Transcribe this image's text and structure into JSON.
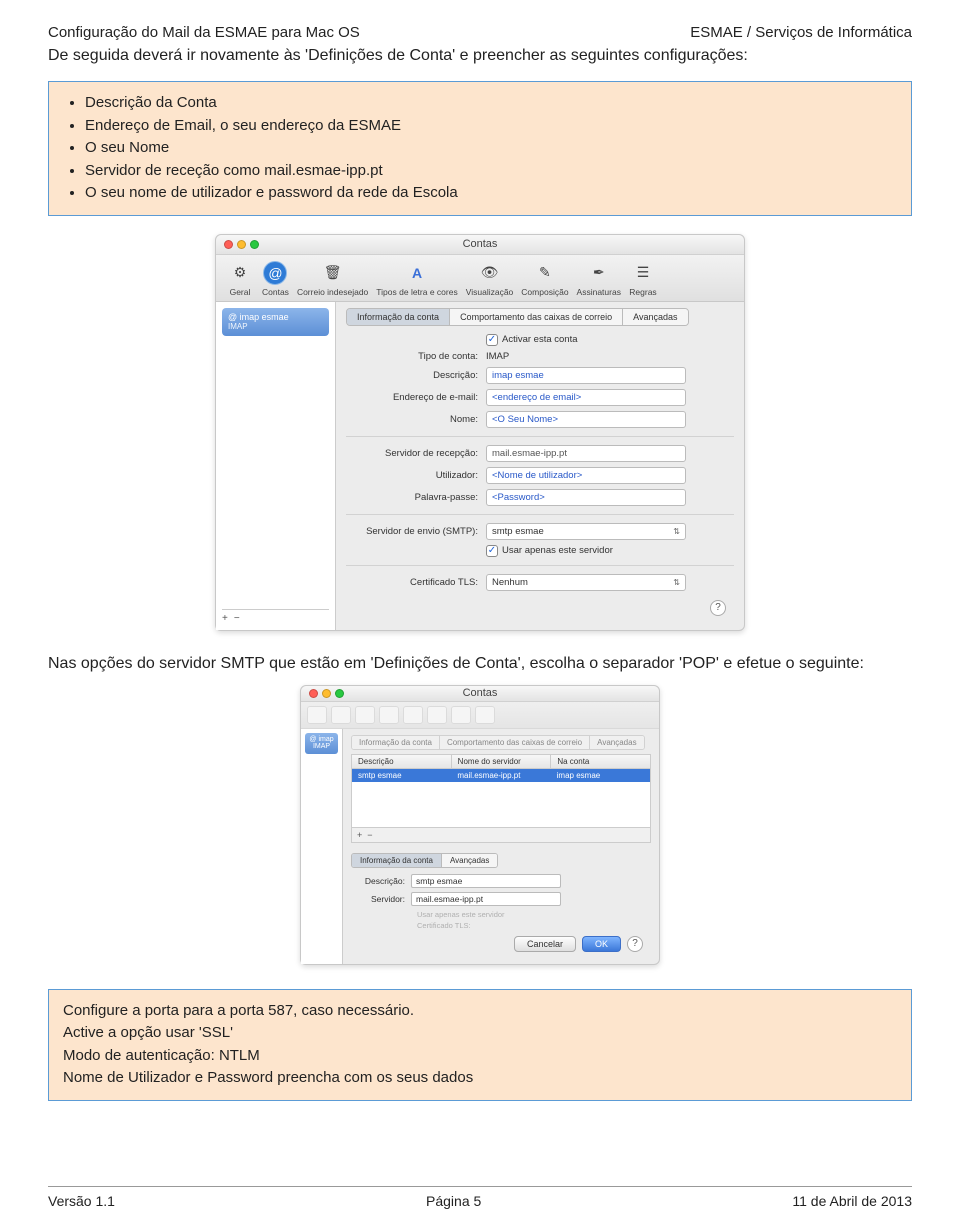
{
  "header": {
    "left": "Configuração do Mail da ESMAE para Mac OS",
    "right": "ESMAE / Serviços de Informática"
  },
  "intro": "De seguida deverá ir novamente às 'Definições de Conta' e preencher as seguintes configurações:",
  "box1_items": [
    "Descrição da Conta",
    "Endereço de Email, o seu endereço da ESMAE",
    "O seu Nome",
    "Servidor de receção como mail.esmae-ipp.pt",
    "O seu nome de utilizador e password da rede da Escola"
  ],
  "win1": {
    "title": "Contas",
    "toolbar": [
      {
        "label": "Geral",
        "icon": "⚙"
      },
      {
        "label": "Contas",
        "icon": "@",
        "sel": true
      },
      {
        "label": "Correio indesejado",
        "icon": "✉"
      },
      {
        "label": "Tipos de letra e cores",
        "icon": "A"
      },
      {
        "label": "Visualização",
        "icon": "👁"
      },
      {
        "label": "Composição",
        "icon": "✎"
      },
      {
        "label": "Assinaturas",
        "icon": "✒"
      },
      {
        "label": "Regras",
        "icon": "☰"
      }
    ],
    "account_name": "imap esmae",
    "account_sub": "IMAP",
    "tabs": [
      "Informação da conta",
      "Comportamento das caixas de correio",
      "Avançadas"
    ],
    "tab_sel": 0,
    "activate_label": "Activar esta conta",
    "type_label": "Tipo de conta:",
    "type_value": "IMAP",
    "desc_label": "Descrição:",
    "desc_value": "imap esmae",
    "email_label": "Endereço de e-mail:",
    "email_value": "<endereço de email>",
    "name_label": "Nome:",
    "name_value": "<O Seu Nome>",
    "recv_label": "Servidor de recepção:",
    "recv_value": "mail.esmae-ipp.pt",
    "user_label": "Utilizador:",
    "user_value": "<Nome de utilizador>",
    "pass_label": "Palavra-passe:",
    "pass_value": "<Password>",
    "smtp_label": "Servidor de envio (SMTP):",
    "smtp_value": "smtp esmae",
    "smtp_only_label": "Usar apenas este servidor",
    "tls_label": "Certificado TLS:",
    "tls_value": "Nenhum",
    "plus": "+",
    "minus": "−",
    "help": "?"
  },
  "midtext": "Nas opções do servidor SMTP que estão em 'Definições de Conta', escolha o separador 'POP' e efetue o seguinte:",
  "win2": {
    "title": "Contas",
    "top_tabs": [
      "Informação da conta",
      "Comportamento das caixas de correio",
      "Avançadas"
    ],
    "table_headers": [
      "Descrição",
      "Nome do servidor",
      "Na conta"
    ],
    "table_row": [
      "smtp esmae",
      "mail.esmae-ipp.pt",
      "imap esmae"
    ],
    "plus": "+",
    "minus": "−",
    "lower_tabs": [
      "Informação da conta",
      "Avançadas"
    ],
    "lower_sel": 0,
    "desc_label": "Descrição:",
    "desc_value": "smtp esmae",
    "serv_label": "Servidor:",
    "serv_value": "mail.esmae-ipp.pt",
    "disabled1": "Usar apenas este servidor",
    "disabled2": "Certificado TLS:",
    "cancel": "Cancelar",
    "ok": "OK",
    "help": "?",
    "acct_name": "imap",
    "acct_sub": "IMAP"
  },
  "box2_lines": [
    "Configure a porta para a porta 587, caso necessário.",
    "Active a opção usar 'SSL'",
    "Modo de autenticação: NTLM",
    "Nome de Utilizador e Password preencha com os seus dados"
  ],
  "footer": {
    "left": "Versão 1.1",
    "center": "Página 5",
    "right": "11 de Abril de 2013"
  }
}
